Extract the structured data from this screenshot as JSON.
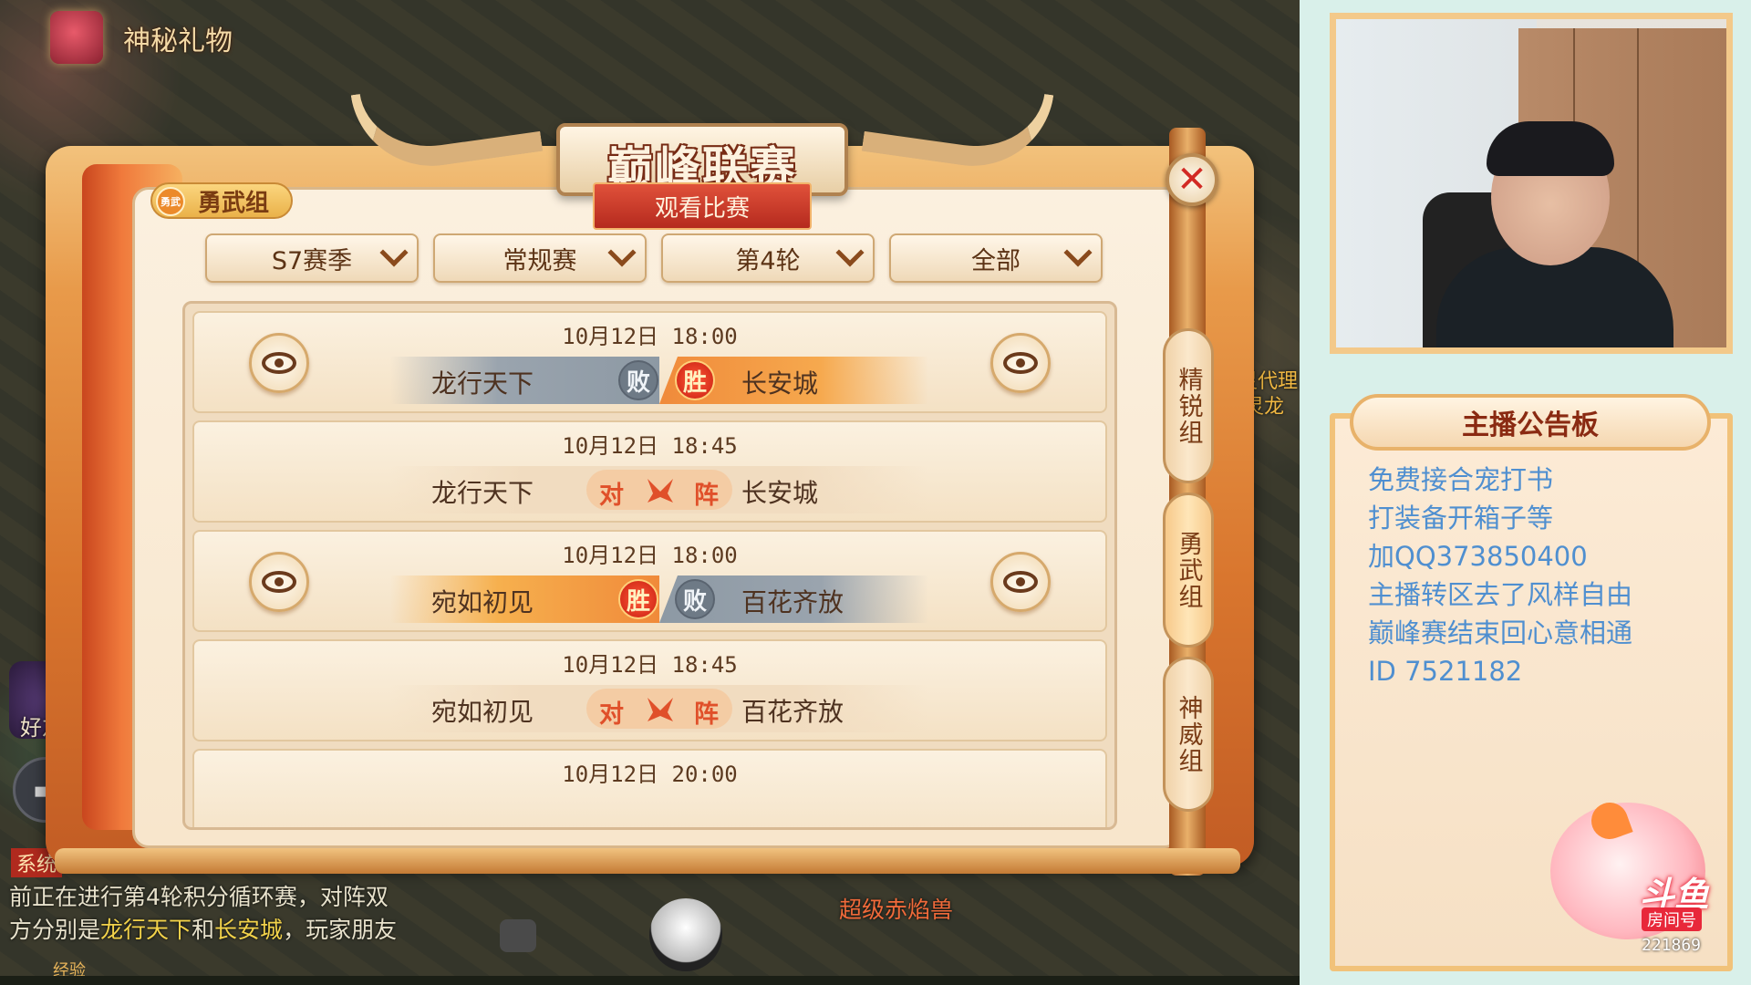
{
  "game": {
    "gift_label": "神秘礼物",
    "friends_label": "好友",
    "system_tag": "系统",
    "system_message_pre": "前正在进行第4轮积分循环赛，对阵双",
    "system_message_line2_pre": "方分别是",
    "team_a": "龙行天下",
    "system_and": "和",
    "team_b": "长安城",
    "system_message_line2_post": "，玩家朋友",
    "bottom_pet": "超级赤焰兽",
    "right_pet_1": "焕灵代理",
    "right_pet_2": "超级灵龙",
    "exp_label": "经验"
  },
  "dialog": {
    "title": "巅峰联赛",
    "subtitle": "观看比赛",
    "group_badge_icon": "勇武",
    "group_badge": "勇武组",
    "filters": [
      {
        "label": "S7赛季"
      },
      {
        "label": "常规赛"
      },
      {
        "label": "第4轮"
      },
      {
        "label": "全部"
      }
    ],
    "side_tabs": [
      {
        "label": "精锐组",
        "active": false
      },
      {
        "label": "勇武组",
        "active": true
      },
      {
        "label": "神威组",
        "active": false
      }
    ],
    "vs_left": "对",
    "vs_right": "阵",
    "win_label": "胜",
    "lose_label": "败",
    "matches": [
      {
        "time": "10月12日 18:00",
        "team_left": "龙行天下",
        "team_right": "长安城",
        "result": "right_win",
        "watchable": true
      },
      {
        "time": "10月12日 18:45",
        "team_left": "龙行天下",
        "team_right": "长安城",
        "result": "pending",
        "watchable": false
      },
      {
        "time": "10月12日 18:00",
        "team_left": "宛如初见",
        "team_right": "百花齐放",
        "result": "left_win",
        "watchable": true
      },
      {
        "time": "10月12日 18:45",
        "team_left": "宛如初见",
        "team_right": "百花齐放",
        "result": "pending",
        "watchable": false
      },
      {
        "time": "10月12日 20:00",
        "team_left": "",
        "team_right": "",
        "result": "pending",
        "watchable": false
      }
    ]
  },
  "streamer": {
    "board_title": "主播公告板",
    "board_lines": [
      "免费接合宠打书",
      "打装备开箱子等",
      "加QQ373850400",
      "主播转区去了风样自由",
      "巅峰赛结束回心意相通",
      "ID 7521182"
    ],
    "logo": "斗鱼",
    "room_label": "房间号",
    "room_id": "221869"
  }
}
